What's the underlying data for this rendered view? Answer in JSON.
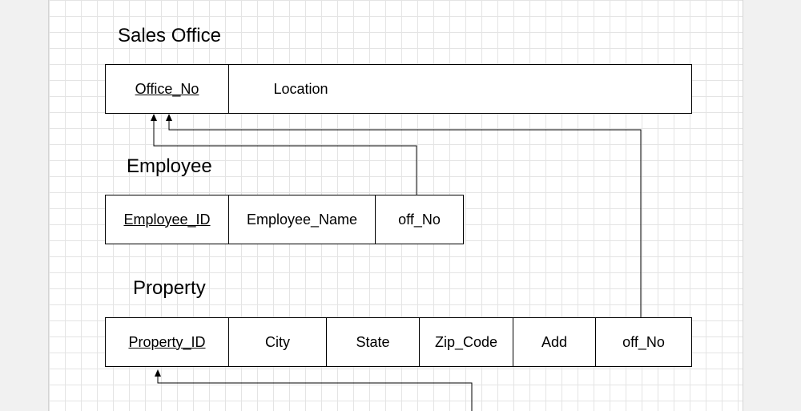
{
  "tables": {
    "sales_office": {
      "title": "Sales Office",
      "columns": [
        {
          "label": "Office_No",
          "primary_key": true
        },
        {
          "label": "Location",
          "primary_key": false
        }
      ]
    },
    "employee": {
      "title": "Employee",
      "columns": [
        {
          "label": "Employee_ID",
          "primary_key": true
        },
        {
          "label": "Employee_Name",
          "primary_key": false
        },
        {
          "label": "off_No",
          "primary_key": false
        }
      ]
    },
    "property": {
      "title": "Property",
      "columns": [
        {
          "label": "Property_ID",
          "primary_key": true
        },
        {
          "label": "City",
          "primary_key": false
        },
        {
          "label": "State",
          "primary_key": false
        },
        {
          "label": "Zip_Code",
          "primary_key": false
        },
        {
          "label": "Add",
          "primary_key": false
        },
        {
          "label": "off_No",
          "primary_key": false
        }
      ]
    }
  },
  "relationships": [
    {
      "from": "employee.off_No",
      "to": "sales_office.Office_No"
    },
    {
      "from": "property.off_No",
      "to": "sales_office.Office_No"
    },
    {
      "from": "off-canvas",
      "to": "property.Property_ID"
    }
  ],
  "colors": {
    "canvas": "#ffffff",
    "grid": "#e4e4e4",
    "outside": "#f1f1f1",
    "lines": "#000000"
  }
}
